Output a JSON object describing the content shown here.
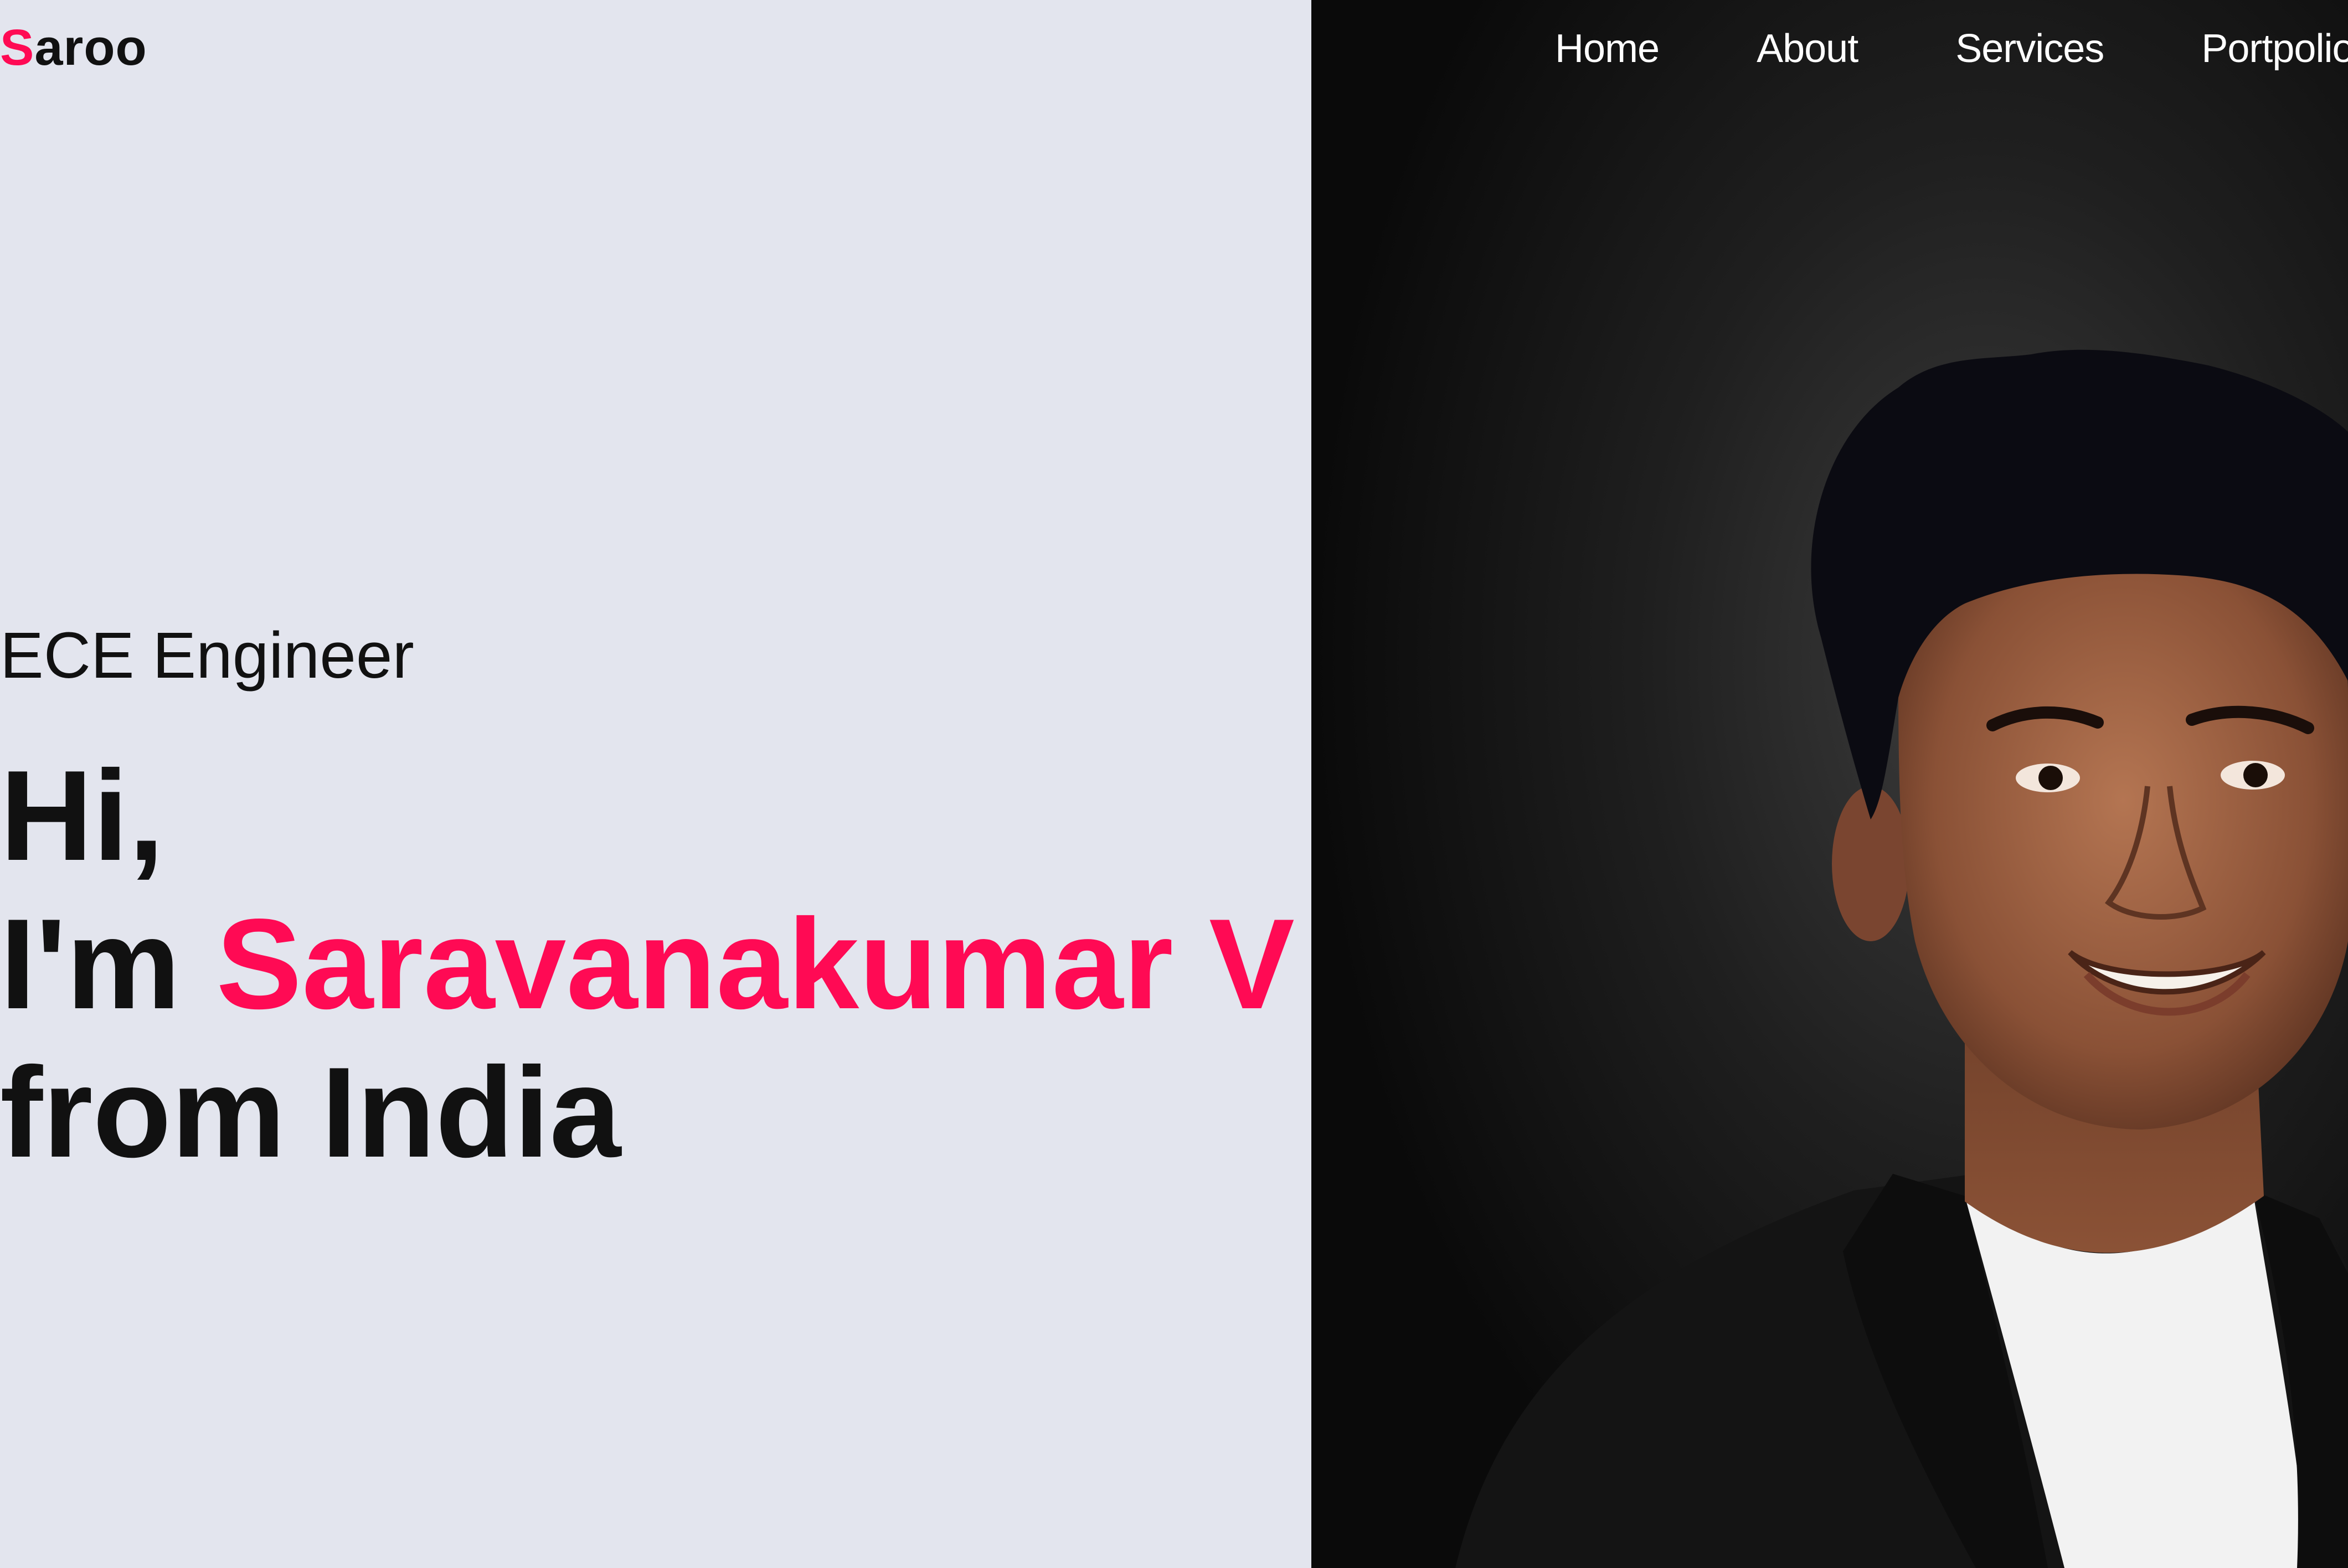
{
  "logo": {
    "accent_letter": "S",
    "rest": "aroo"
  },
  "nav": {
    "items": [
      {
        "label": "Home"
      },
      {
        "label": "About"
      },
      {
        "label": "Services"
      },
      {
        "label": "Portpolio"
      }
    ]
  },
  "hero": {
    "subtitle": "ECE Engineer",
    "line1": "Hi,",
    "line2_prefix": "I'm ",
    "name": "Saravanakumar V",
    "line3": "from India"
  },
  "colors": {
    "accent": "#ff0a54",
    "left_background": "#e3e5ee",
    "right_background": "#151515",
    "text_dark": "#111111",
    "nav_text": "#ffffff"
  },
  "icons": {
    "portrait": "person-photo"
  }
}
